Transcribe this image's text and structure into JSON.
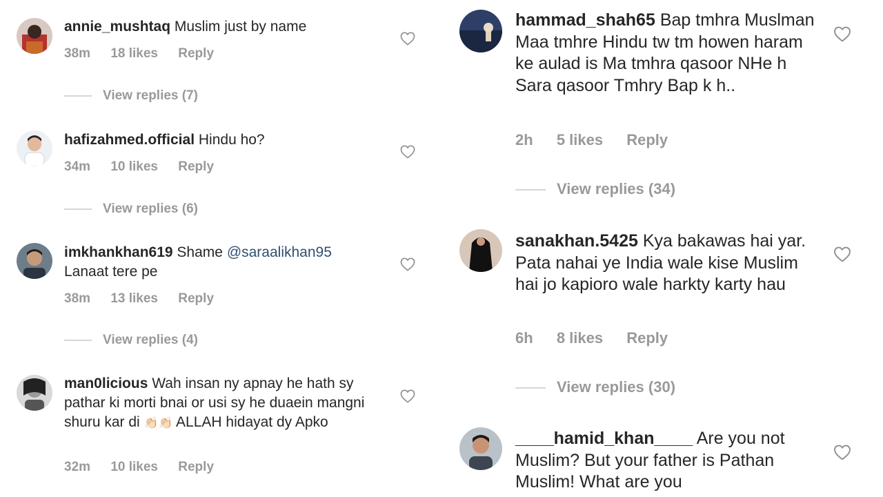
{
  "left": [
    {
      "username": "annie_mushtaq",
      "text": "Muslim just by name",
      "time": "38m",
      "likes": "18 likes",
      "reply": "Reply",
      "view_replies": "View replies (7)"
    },
    {
      "username": "hafizahmed.official",
      "text": "Hindu ho?",
      "time": "34m",
      "likes": "10 likes",
      "reply": "Reply",
      "view_replies": "View replies (6)"
    },
    {
      "username": "imkhankhan619",
      "text_before": "Shame",
      "mention": "@saraalikhan95",
      "text_after": "Lanaat tere pe",
      "time": "38m",
      "likes": "13 likes",
      "reply": "Reply",
      "view_replies": "View replies (4)"
    },
    {
      "username": "man0licious",
      "text": "Wah insan ny apnay he hath sy pathar ki morti bnai or usi sy he duaein mangni shuru kar di",
      "emoji": "👏🏻👏🏻",
      "text_after": "ALLAH hidayat dy Apko",
      "time": "32m",
      "likes": "10 likes",
      "reply": "Reply"
    }
  ],
  "right": [
    {
      "username": "hammad_shah65",
      "text": "Bap tmhra Muslman Maa tmhre Hindu tw tm howen haram ke aulad is Ma tmhra qasoor NHe h Sara qasoor Tmhry Bap k h..",
      "time": "2h",
      "likes": "5 likes",
      "reply": "Reply",
      "view_replies": "View replies (34)"
    },
    {
      "username": "sanakhan.5425",
      "text": "Kya bakawas hai yar.  Pata nahai ye India wale kise Muslim hai jo kapioro wale harkty karty hau",
      "time": "6h",
      "likes": "8 likes",
      "reply": "Reply",
      "view_replies": "View replies (30)"
    },
    {
      "username": "____hamid_khan____",
      "text": "Are you not Muslim? But your father is Pathan Muslim! What are you"
    }
  ],
  "icons": {
    "like": "heart-outline-icon"
  },
  "colors": {
    "muted": "#999999",
    "mention": "#2f4f73",
    "text": "#262626"
  }
}
